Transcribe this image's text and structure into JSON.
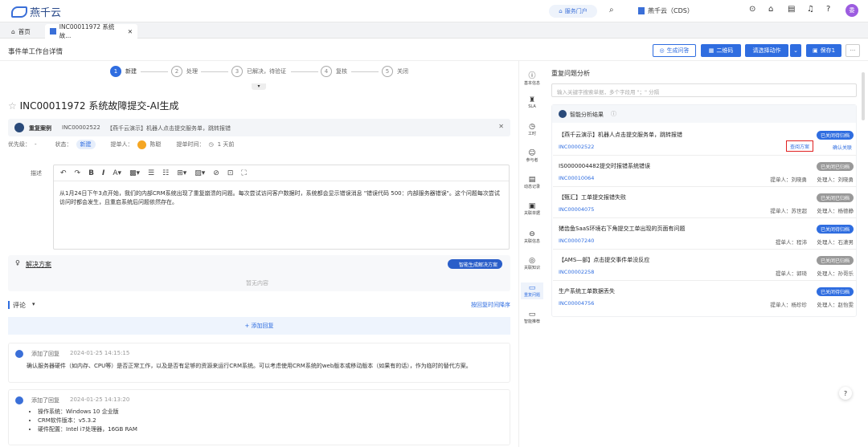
{
  "app": {
    "logo": "燕千云",
    "portal": "服务门户",
    "tenant": "燕千云（CDS）",
    "user_initial": "委"
  },
  "tabs": [
    {
      "label": "首页"
    },
    {
      "label": "INC00011972 系统故..."
    }
  ],
  "header": {
    "page_title": "事件单工作台详情",
    "btn_survey": "生成问答",
    "btn_qr": "二维码",
    "btn_action": "请选择动作",
    "btn_save": "保存1",
    "btn_more": "···"
  },
  "steps": [
    {
      "num": "1",
      "label": "新建"
    },
    {
      "num": "2",
      "label": "处理"
    },
    {
      "num": "3",
      "label": "已解决，待验证"
    },
    {
      "num": "4",
      "label": "复核"
    },
    {
      "num": "5",
      "label": "关闭"
    }
  ],
  "ticket": {
    "id": "INC00011972",
    "title": "系统故障提交-AI生成"
  },
  "duplicate": {
    "label": "重复案例",
    "id": "INC00002522",
    "text": "【燕千云演示】机器人点击提交服务单，跳转报错"
  },
  "meta": {
    "priority_label": "优先级：",
    "priority": "-",
    "status_label": "状态：",
    "status": "新建",
    "submitter_label": "提单人：",
    "submitter": "陈聪",
    "time_label": "提单时间：",
    "time": "1 天前"
  },
  "description": {
    "label": "描述",
    "text": "从1月24日下午3点开始，我们的内部CRM系统出现了重复崩溃的问题。每次尝试访问客户数据时，系统都会显示错误消息 \"错误代码 500：内部服务器错误\"。这个问题每次尝试访问时都会发生，且重启系统后问题依然存在。"
  },
  "solution": {
    "label": "解决方案",
    "ai_btn": "智能生成解决方案",
    "empty": "暂无内容"
  },
  "comments_section": {
    "label": "评论",
    "sort": "按回复时间降序",
    "add": "+ 添加回复"
  },
  "comments": [
    {
      "action": "添加了回复",
      "time": "2024-01-25 14:15:15",
      "text": "确认服务器硬件（如内存、CPU等）是否正常工作，以及是否有足够的资源来运行CRM系统。可以考虑使用CRM系统的web版本或移动版本（如果有的话），作为临时的替代方案。"
    },
    {
      "action": "添加了回复",
      "time": "2024-01-25 14:13:20",
      "items": [
        "操作系统：Windows 10 企业版",
        "CRM软件版本：v5.3.2",
        "硬件配置：Intel i7处理器，16GB RAM"
      ]
    }
  ],
  "iconbar": [
    {
      "icon": "info-icon",
      "glyph": "ⓘ",
      "label": "基本信息"
    },
    {
      "icon": "sla-icon",
      "glyph": "♜",
      "label": "SLA"
    },
    {
      "icon": "clock-icon",
      "glyph": "◷",
      "label": "工时"
    },
    {
      "icon": "people-icon",
      "glyph": "☺",
      "label": "参与者"
    },
    {
      "icon": "log-icon",
      "glyph": "▤",
      "label": "动态记录"
    },
    {
      "icon": "doc-icon",
      "glyph": "▣",
      "label": "关联单据"
    },
    {
      "icon": "link-icon",
      "glyph": "⊖",
      "label": "关联信息"
    },
    {
      "icon": "knowledge-icon",
      "glyph": "◎",
      "label": "关联知识"
    },
    {
      "icon": "repeat-icon",
      "glyph": "▭",
      "label": "重复问题"
    },
    {
      "icon": "monitor-icon",
      "glyph": "▭",
      "label": "智能推荐"
    }
  ],
  "right": {
    "title": "重复问题分析",
    "search_placeholder": "输入关键字搜索单据，多个字段用 \"；\" 分隔",
    "ai_title": "智能分析结果",
    "view_btn": "查阅方案",
    "confirm_btn": "确认关联",
    "cards": [
      {
        "title": "【燕千云演示】机器人点击提交服务单，跳转报错",
        "id": "INC00002522",
        "badge": "已关闭待归档",
        "badge_color": "blue",
        "submitter": "",
        "handler": ""
      },
      {
        "title": "IS0000004482提交时报错系统错误",
        "id": "INC00010064",
        "badge": "已关闭已归档",
        "badge_color": "gray",
        "submitter": "提单人：刘晓勇",
        "handler": "处理人：刘晓勇"
      },
      {
        "title": "【甄汇】工单提交报错失败",
        "id": "INC00004075",
        "badge": "已关闭已归档",
        "badge_color": "gray",
        "submitter": "提单人：苏世超",
        "handler": "处理人：杨德静"
      },
      {
        "title": "猪齿鱼SaaS环境右下角提交工单出现的页面有问题",
        "id": "INC00007240",
        "badge": "已关闭待归档",
        "badge_color": "blue",
        "submitter": "提单人：程沛",
        "handler": "处理人：石潇男"
      },
      {
        "title": "【AMS—部】点击提交事件单没反应",
        "id": "INC00002258",
        "badge": "已关闭已归档",
        "badge_color": "gray",
        "submitter": "提单人：郭琦",
        "handler": "处理人：孙哥乐"
      },
      {
        "title": "生产系统工单数据丢失",
        "id": "INC00004756",
        "badge": "已关闭待归档",
        "badge_color": "blue",
        "submitter": "提单人：杨珍珍",
        "handler": "处理人：赵怡雯"
      }
    ]
  }
}
